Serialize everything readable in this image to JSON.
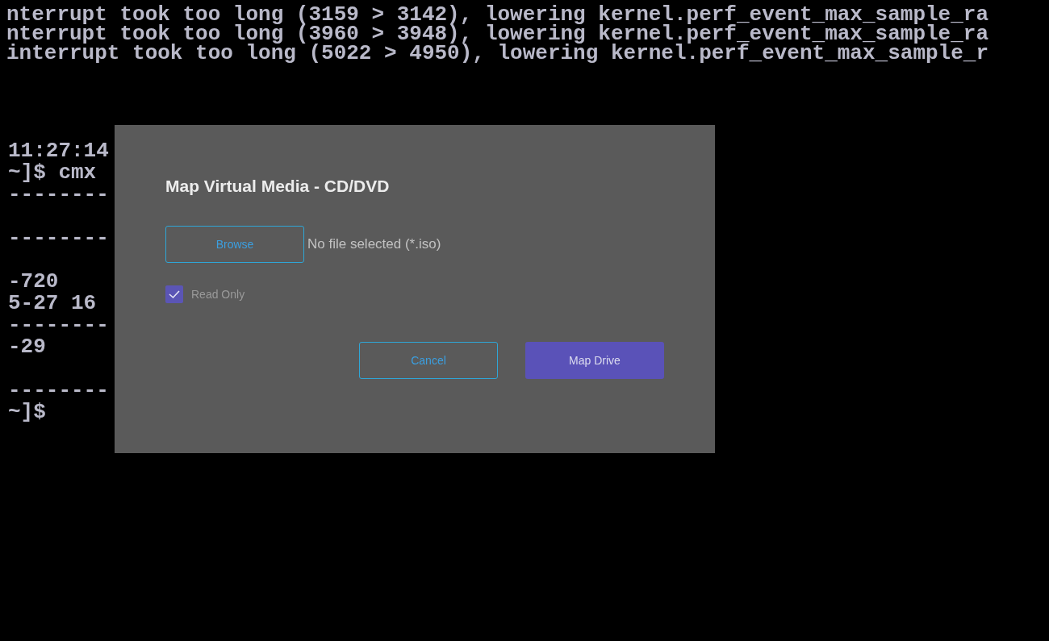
{
  "terminal": {
    "top_lines": [
      "nterrupt took too long (3159 > 3142), lowering kernel.perf_event_max_sample_ra",
      "nterrupt took too long (3960 > 3948), lowering kernel.perf_event_max_sample_ra",
      "interrupt took too long (5022 > 4950), lowering kernel.perf_event_max_sample_r"
    ],
    "left_lines": [
      "11:27:14",
      "~]$ cmx",
      "--------",
      "--------",
      "-720",
      "5-27 16",
      "--------",
      "-29",
      "--------",
      "~]$"
    ]
  },
  "dialog": {
    "title": "Map Virtual Media - CD/DVD",
    "browse_button": "Browse",
    "file_status": "No file selected (*.iso)",
    "read_only": {
      "label": "Read Only",
      "checked": true
    },
    "buttons": [
      {
        "label": "Cancel",
        "kind": "secondary"
      },
      {
        "label": "Map Drive",
        "kind": "primary"
      }
    ]
  }
}
